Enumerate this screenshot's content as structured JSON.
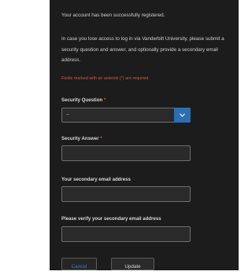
{
  "messages": {
    "success": "Your account has been successfully registered.",
    "info": "In case you lose access to log in via Vanderbilt University, please submit a security question and answer, and optionally provide a secondary email address.",
    "required_note": "Fields marked with an asterisk (*) are required."
  },
  "form": {
    "security_question": {
      "label": "Security Question",
      "required_mark": "*",
      "selected_value": "--"
    },
    "security_answer": {
      "label": "Security Answer",
      "required_mark": "*",
      "value": ""
    },
    "secondary_email": {
      "label": "Your secondary email address",
      "value": ""
    },
    "verify_secondary_email": {
      "label": "Please verify your secondary email address",
      "value": ""
    }
  },
  "buttons": {
    "cancel_label": "Cancel",
    "update_label": "Update"
  },
  "colors": {
    "panel_background": "#1c1c1c",
    "required_text": "#d65a3a",
    "asterisk": "#e2563a",
    "select_arrow_accent": "#2c6fb0",
    "cancel_text": "#3d7fc4"
  },
  "icons": {
    "select_arrow": "chevron-down-icon"
  }
}
